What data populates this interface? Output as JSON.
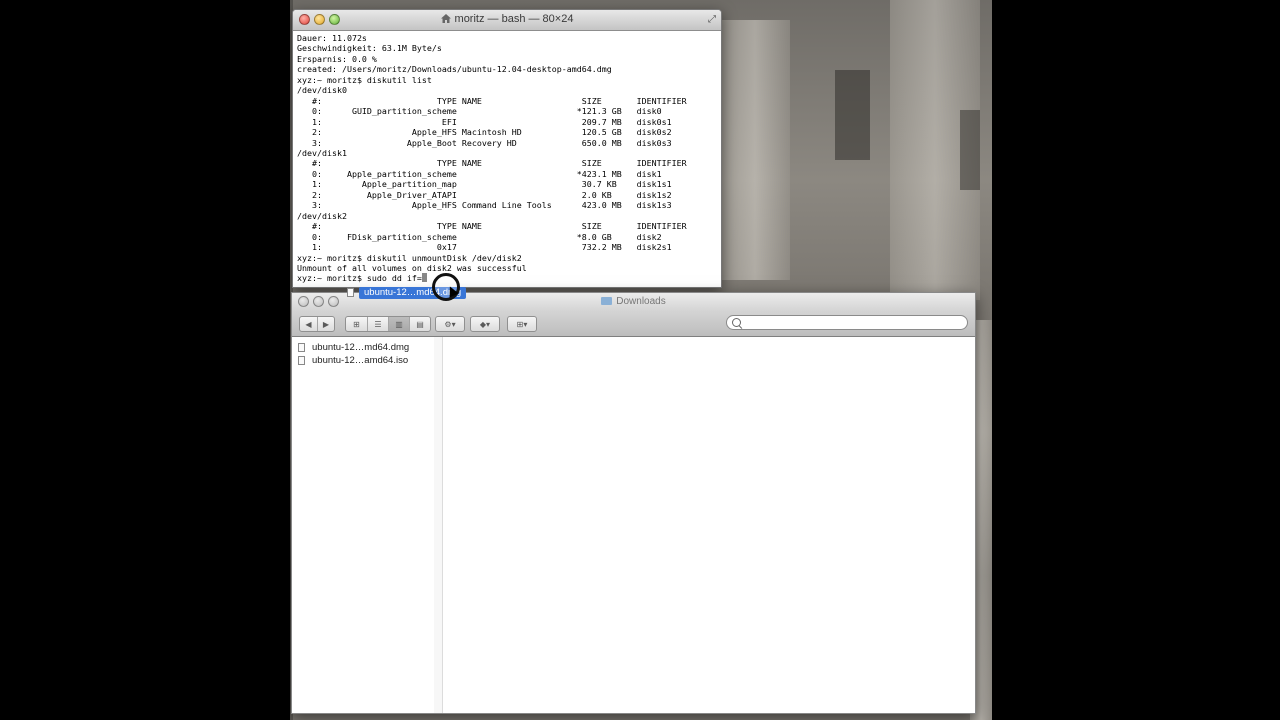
{
  "terminal": {
    "title": "moritz — bash — 80×24",
    "lines": [
      "Dauer: 11.072s",
      "Geschwindigkeit: 63.1M Byte/s",
      "Ersparnis: 0.0 %",
      "created: /Users/moritz/Downloads/ubuntu-12.04-desktop-amd64.dmg",
      "xyz:~ moritz$ diskutil list",
      "/dev/disk0",
      "   #:                       TYPE NAME                    SIZE       IDENTIFIER",
      "   0:      GUID_partition_scheme                        *121.3 GB   disk0",
      "   1:                        EFI                         209.7 MB   disk0s1",
      "   2:                  Apple_HFS Macintosh HD            120.5 GB   disk0s2",
      "   3:                 Apple_Boot Recovery HD             650.0 MB   disk0s3",
      "/dev/disk1",
      "   #:                       TYPE NAME                    SIZE       IDENTIFIER",
      "   0:     Apple_partition_scheme                        *423.1 MB   disk1",
      "   1:        Apple_partition_map                         30.7 KB    disk1s1",
      "   2:         Apple_Driver_ATAPI                         2.0 KB     disk1s2",
      "   3:                  Apple_HFS Command Line Tools      423.0 MB   disk1s3",
      "/dev/disk2",
      "   #:                       TYPE NAME                    SIZE       IDENTIFIER",
      "   0:     FDisk_partition_scheme                        *8.0 GB     disk2",
      "   1:                       0x17                         732.2 MB   disk2s1",
      "xyz:~ moritz$ diskutil unmountDisk /dev/disk2",
      "Unmount of all volumes on disk2 was successful"
    ],
    "prompt_line": "xyz:~ moritz$ sudo dd if="
  },
  "finder": {
    "title": "Downloads",
    "search_placeholder": "",
    "files": [
      {
        "name": "ubuntu-12…md64.dmg"
      },
      {
        "name": "ubuntu-12…amd64.iso"
      }
    ]
  },
  "drag_item": {
    "label": "ubuntu-12…md64.dmg"
  }
}
